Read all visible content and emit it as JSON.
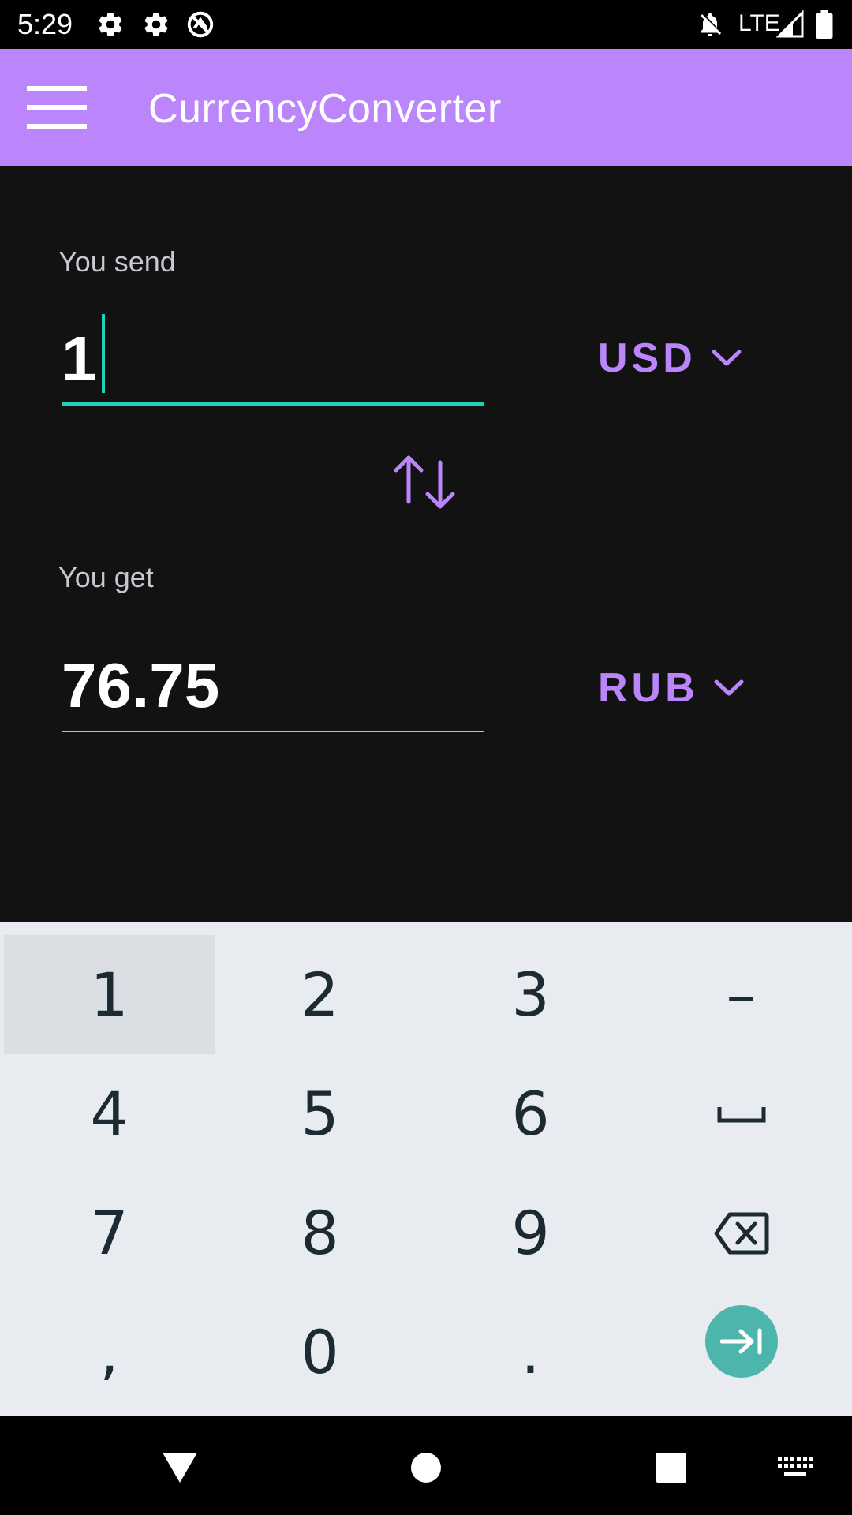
{
  "status_bar": {
    "time": "5:29",
    "network": "LTE",
    "icons": [
      "settings-icon",
      "settings-icon",
      "sync-icon",
      "notifications-off-icon",
      "signal-icon",
      "battery-icon"
    ]
  },
  "app_bar": {
    "title": "CurrencyConverter",
    "menu_icon": "hamburger-menu-icon",
    "color": "#bb86fc"
  },
  "converter": {
    "send": {
      "label": "You send",
      "amount": "1",
      "currency": "USD"
    },
    "get": {
      "label": "You get",
      "amount": "76.75",
      "currency": "RUB"
    },
    "swap_icon": "swap-vertical-icon",
    "accent_color": "#1fd1b5"
  },
  "keyboard": {
    "rows": [
      [
        "1",
        "2",
        "3",
        "–"
      ],
      [
        "4",
        "5",
        "6",
        "space"
      ],
      [
        "7",
        "8",
        "9",
        "backspace"
      ],
      [
        ",",
        "0",
        ".",
        "next"
      ]
    ],
    "pressed_key": "1",
    "enter_color": "#4db6ac"
  },
  "nav_bar": {
    "buttons": [
      "back-icon",
      "home-icon",
      "recents-icon",
      "keyboard-icon"
    ]
  }
}
